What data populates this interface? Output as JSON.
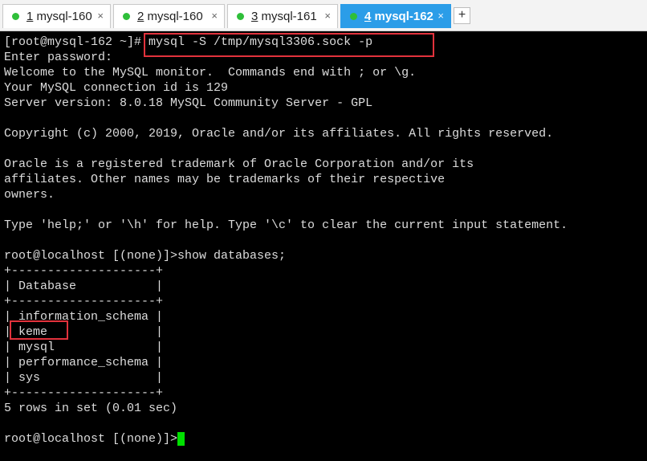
{
  "tabs": [
    {
      "number": "1",
      "title": "mysql-160",
      "close": "×"
    },
    {
      "number": "2",
      "title": "mysql-160",
      "close": "×"
    },
    {
      "number": "3",
      "title": "mysql-161",
      "close": "×"
    },
    {
      "number": "4",
      "title": "mysql-162",
      "close": "×"
    }
  ],
  "add_tab_label": "+",
  "colors": {
    "active_tab": "#2b9de8",
    "status_dot": "#2fbf3a",
    "highlight_box": "#e2323c",
    "cursor": "#00e000"
  },
  "terminal": {
    "lines": [
      "[root@mysql-162 ~]# mysql -S /tmp/mysql3306.sock -p",
      "Enter password:",
      "Welcome to the MySQL monitor.  Commands end with ; or \\g.",
      "Your MySQL connection id is 129",
      "Server version: 8.0.18 MySQL Community Server - GPL",
      "",
      "Copyright (c) 2000, 2019, Oracle and/or its affiliates. All rights reserved.",
      "",
      "Oracle is a registered trademark of Oracle Corporation and/or its",
      "affiliates. Other names may be trademarks of their respective",
      "owners.",
      "",
      "Type 'help;' or '\\h' for help. Type '\\c' to clear the current input statement.",
      "",
      "root@localhost [(none)]>show databases;",
      "+--------------------+",
      "| Database           |",
      "+--------------------+",
      "| information_schema |",
      "| keme               |",
      "| mysql              |",
      "| performance_schema |",
      "| sys                |",
      "+--------------------+",
      "5 rows in set (0.01 sec)",
      "",
      "root@localhost [(none)]>"
    ]
  }
}
